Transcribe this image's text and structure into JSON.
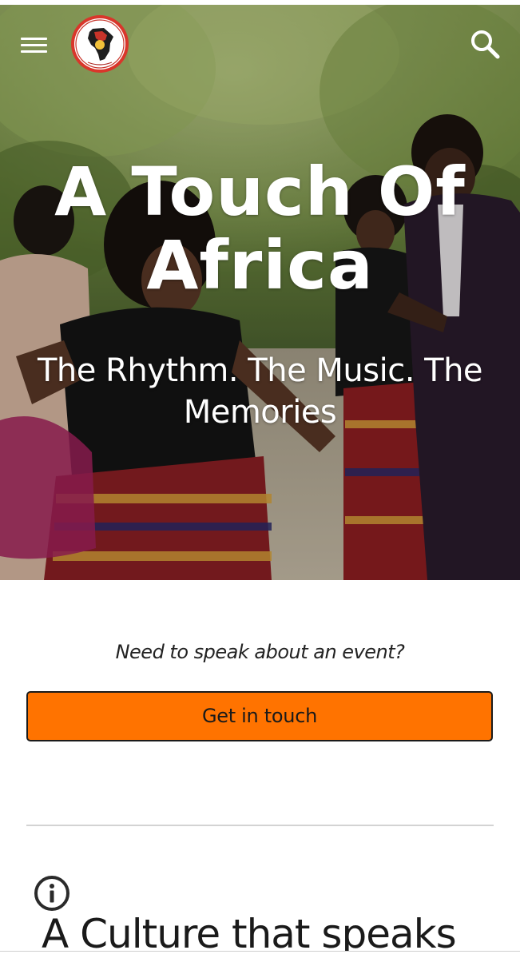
{
  "header": {
    "menu_icon": "hamburger-menu-icon",
    "logo_icon": "africa-logo-icon",
    "search_icon": "search-icon"
  },
  "hero": {
    "title": "A Touch Of Africa",
    "subtitle": "The Rhythm. The Music. The Memories"
  },
  "contact": {
    "prompt": "Need to speak about an event?",
    "button_label": "Get in touch"
  },
  "about": {
    "info_icon": "info-icon",
    "heading": "A Culture that speaks"
  },
  "colors": {
    "accent": "#ff7300",
    "text": "#1a1a1a",
    "divider": "#d3d3d3"
  }
}
